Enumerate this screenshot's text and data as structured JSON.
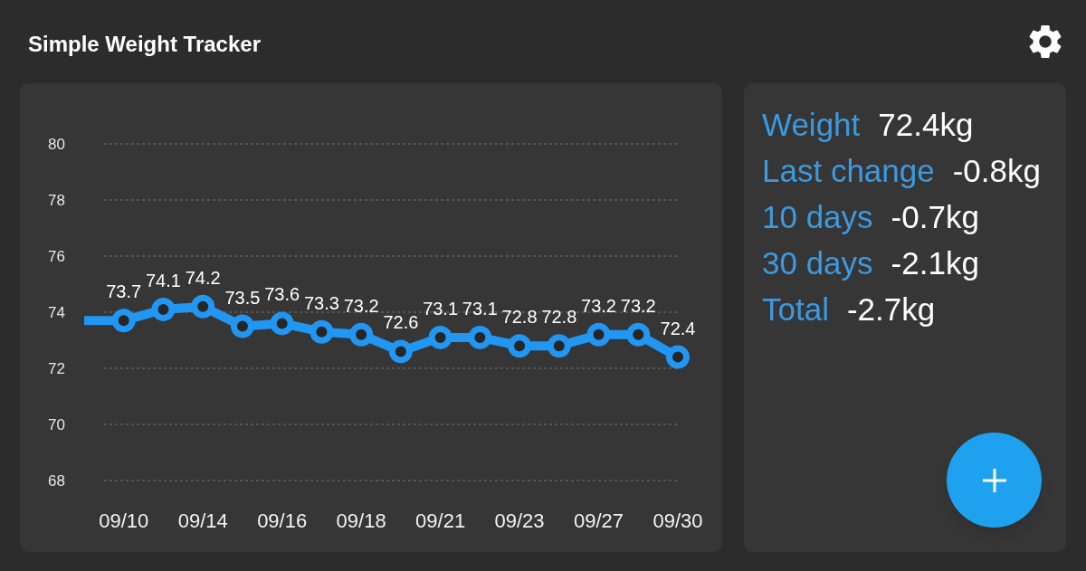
{
  "app_bar": {
    "title": "Simple Weight Tracker"
  },
  "chart": {
    "chart_data": {
      "type": "line",
      "categories": [
        null,
        "09/10",
        null,
        "09/14",
        null,
        "09/16",
        null,
        "09/18",
        null,
        "09/21",
        null,
        "09/23",
        null,
        "09/27",
        null,
        "09/30"
      ],
      "ylim": [
        68,
        80
      ],
      "yticks": [
        68,
        70,
        72,
        74,
        76,
        78,
        80
      ],
      "grid": true,
      "series": [
        {
          "color": "#2196f3",
          "marker": "circle",
          "values": [
            73.7,
            73.7,
            74.1,
            74.2,
            73.5,
            73.6,
            73.3,
            73.2,
            72.6,
            73.1,
            73.1,
            72.8,
            72.8,
            73.2,
            73.2,
            72.4
          ]
        }
      ],
      "value_labels": [
        null,
        "73.7",
        "74.1",
        "74.2",
        "73.5",
        "73.6",
        "73.3",
        "73.2",
        "72.6",
        "73.1",
        "73.1",
        "72.8",
        "72.8",
        "73.2",
        "73.2",
        "72.4"
      ]
    }
  },
  "stats": [
    {
      "label": "Weight",
      "value": "72.4kg"
    },
    {
      "label": "Last change",
      "value": "-0.8kg"
    },
    {
      "label": "10 days",
      "value": "-0.7kg"
    },
    {
      "label": "30 days",
      "value": "-2.1kg"
    },
    {
      "label": "Total",
      "value": "-2.7kg"
    }
  ]
}
